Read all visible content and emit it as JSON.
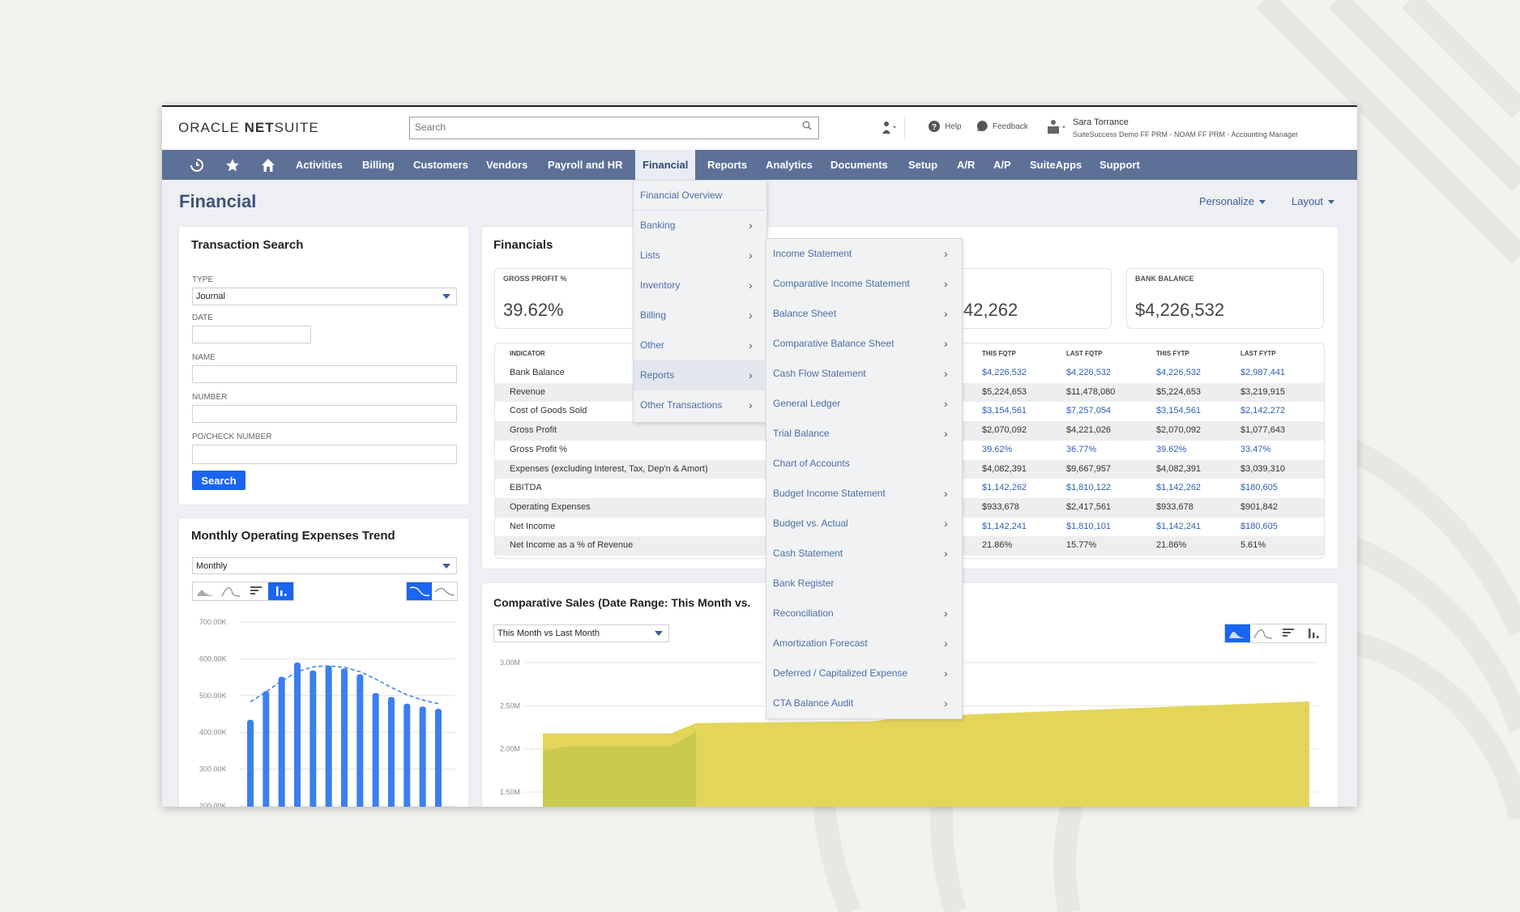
{
  "colors": {
    "nav_bg": "#5d7197",
    "accent": "#1a66f0",
    "link": "#2f5fb3",
    "bars": "#3d7ef0",
    "area_last_month": "#e3d55a",
    "area_this_month": "#c6c84a"
  },
  "header": {
    "logo": {
      "oracle": "ORACLE",
      "net": "NET",
      "suite": "SUITE"
    },
    "search_placeholder": "Search",
    "help": "Help",
    "feedback": "Feedback",
    "user_name": "Sara Torrance",
    "user_role": "SuiteSuccess Demo FF PRM - NOAM FF PRM - Accounting Manager",
    "icons": [
      "recent-icon",
      "star-icon",
      "home-icon",
      "search-icon",
      "user-switch-icon",
      "help-icon",
      "feedback-icon",
      "role-icon"
    ]
  },
  "nav": {
    "items": [
      "Activities",
      "Billing",
      "Customers",
      "Vendors",
      "Payroll and HR",
      "Financial",
      "Reports",
      "Analytics",
      "Documents",
      "Setup",
      "A/R",
      "A/P",
      "SuiteApps",
      "Support"
    ],
    "active": "Financial"
  },
  "page": {
    "title": "Financial",
    "personalize": "Personalize",
    "layout": "Layout"
  },
  "transaction_search": {
    "title": "Transaction Search",
    "type_label": "TYPE",
    "type_value": "Journal",
    "date_label": "DATE",
    "name_label": "NAME",
    "number_label": "NUMBER",
    "po_label": "PO/CHECK NUMBER",
    "search_button": "Search"
  },
  "monthly": {
    "title": "Monthly Operating Expenses Trend",
    "period": "Monthly"
  },
  "financials": {
    "title": "Financials",
    "cards": [
      {
        "label": "GROSS PROFIT %",
        "value": "39.62%"
      },
      {
        "label": "",
        "value": "42,262"
      },
      {
        "label": "BANK BALANCE",
        "value": "$4,226,532"
      }
    ],
    "columns": [
      "INDICATOR",
      "THIS FQTP",
      "LAST FQTP",
      "THIS FYTP",
      "LAST FYTP"
    ],
    "rows": [
      [
        "Bank Balance",
        "$4,226,532",
        "$4,226,532",
        "$4,226,532",
        "$2,987,441"
      ],
      [
        "Revenue",
        "$5,224,653",
        "$11,478,080",
        "$5,224,653",
        "$3,219,915"
      ],
      [
        "Cost of Goods Sold",
        "$3,154,561",
        "$7,257,054",
        "$3,154,561",
        "$2,142,272"
      ],
      [
        "Gross Profit",
        "$2,070,092",
        "$4,221,026",
        "$2,070,092",
        "$1,077,643"
      ],
      [
        "Gross Profit %",
        "39.62%",
        "36.77%",
        "39.62%",
        "33.47%"
      ],
      [
        "Expenses (excluding Interest, Tax, Dep'n & Amort)",
        "$4,082,391",
        "$9,667,957",
        "$4,082,391",
        "$3,039,310"
      ],
      [
        "EBITDA",
        "$1,142,262",
        "$1,810,122",
        "$1,142,262",
        "$180,605"
      ],
      [
        "Operating Expenses",
        "$933,678",
        "$2,417,561",
        "$933,678",
        "$901,842"
      ],
      [
        "Net Income",
        "$1,142,241",
        "$1,810,101",
        "$1,142,241",
        "$180,605"
      ],
      [
        "Net Income as a % of Revenue",
        "21.86%",
        "15.77%",
        "21.86%",
        "5.61%"
      ]
    ]
  },
  "comparative_sales": {
    "title": "Comparative Sales (Date Range: This Month vs.",
    "range": "This Month vs Last Month"
  },
  "financial_menu": {
    "items": [
      {
        "label": "Financial Overview",
        "sub": false
      },
      {
        "label": "Banking",
        "sub": true
      },
      {
        "label": "Lists",
        "sub": true
      },
      {
        "label": "Inventory",
        "sub": true
      },
      {
        "label": "Billing",
        "sub": true
      },
      {
        "label": "Other",
        "sub": true
      },
      {
        "label": "Reports",
        "sub": true,
        "highlighted": true
      },
      {
        "label": "Other Transactions",
        "sub": true
      }
    ]
  },
  "reports_menu": {
    "items": [
      {
        "label": "Income Statement",
        "sub": true
      },
      {
        "label": "Comparative Income Statement",
        "sub": true
      },
      {
        "label": "Balance Sheet",
        "sub": true
      },
      {
        "label": "Comparative Balance Sheet",
        "sub": true
      },
      {
        "label": "Cash Flow Statement",
        "sub": true
      },
      {
        "label": "General Ledger",
        "sub": true
      },
      {
        "label": "Trial Balance",
        "sub": true
      },
      {
        "label": "Chart of Accounts",
        "sub": false
      },
      {
        "label": "Budget Income Statement",
        "sub": true
      },
      {
        "label": "Budget vs. Actual",
        "sub": true
      },
      {
        "label": "Cash Statement",
        "sub": true
      },
      {
        "label": "Bank Register",
        "sub": false
      },
      {
        "label": "Reconciliation",
        "sub": true
      },
      {
        "label": "Amortization Forecast",
        "sub": true
      },
      {
        "label": "Deferred / Capitalized Expense",
        "sub": true
      },
      {
        "label": "CTA Balance Audit",
        "sub": true
      }
    ]
  },
  "chart_data": [
    {
      "type": "bar",
      "title": "Monthly Operating Expenses Trend",
      "ylim": [
        200000,
        700000
      ],
      "yticks": [
        "700.00K",
        "600.00K",
        "500.00K",
        "400.00K",
        "300.00K",
        "200.00K"
      ],
      "ytick_values": [
        700000,
        600000,
        500000,
        400000,
        300000,
        200000
      ],
      "grid": true,
      "values": [
        434000,
        512000,
        551000,
        590000,
        568000,
        581000,
        574000,
        558000,
        507000,
        496000,
        478000,
        470000,
        464000
      ],
      "trend": [
        483000,
        510000,
        540000,
        565000,
        578000,
        581000,
        577000,
        565000,
        545000,
        522000,
        502000,
        488000,
        478000
      ]
    },
    {
      "type": "area",
      "title": "Comparative Sales (Date Range: This Month vs.",
      "ylim": [
        1500000,
        3000000
      ],
      "yticks": [
        "3.00M",
        "2.50M",
        "2.00M",
        "1.50M"
      ],
      "ytick_values": [
        3000000,
        2500000,
        2000000,
        1500000
      ],
      "grid": true,
      "series": [
        {
          "points": [
            [
              1,
              2180000
            ],
            [
              6,
              2180000
            ],
            [
              7,
              2300000
            ],
            [
              14,
              2320000
            ],
            [
              15,
              2370000
            ],
            [
              31,
              2550000
            ]
          ]
        },
        {
          "points": [
            [
              1,
              1980000
            ],
            [
              2,
              2030000
            ],
            [
              6,
              2030000
            ],
            [
              7,
              2200000
            ]
          ]
        }
      ]
    }
  ]
}
